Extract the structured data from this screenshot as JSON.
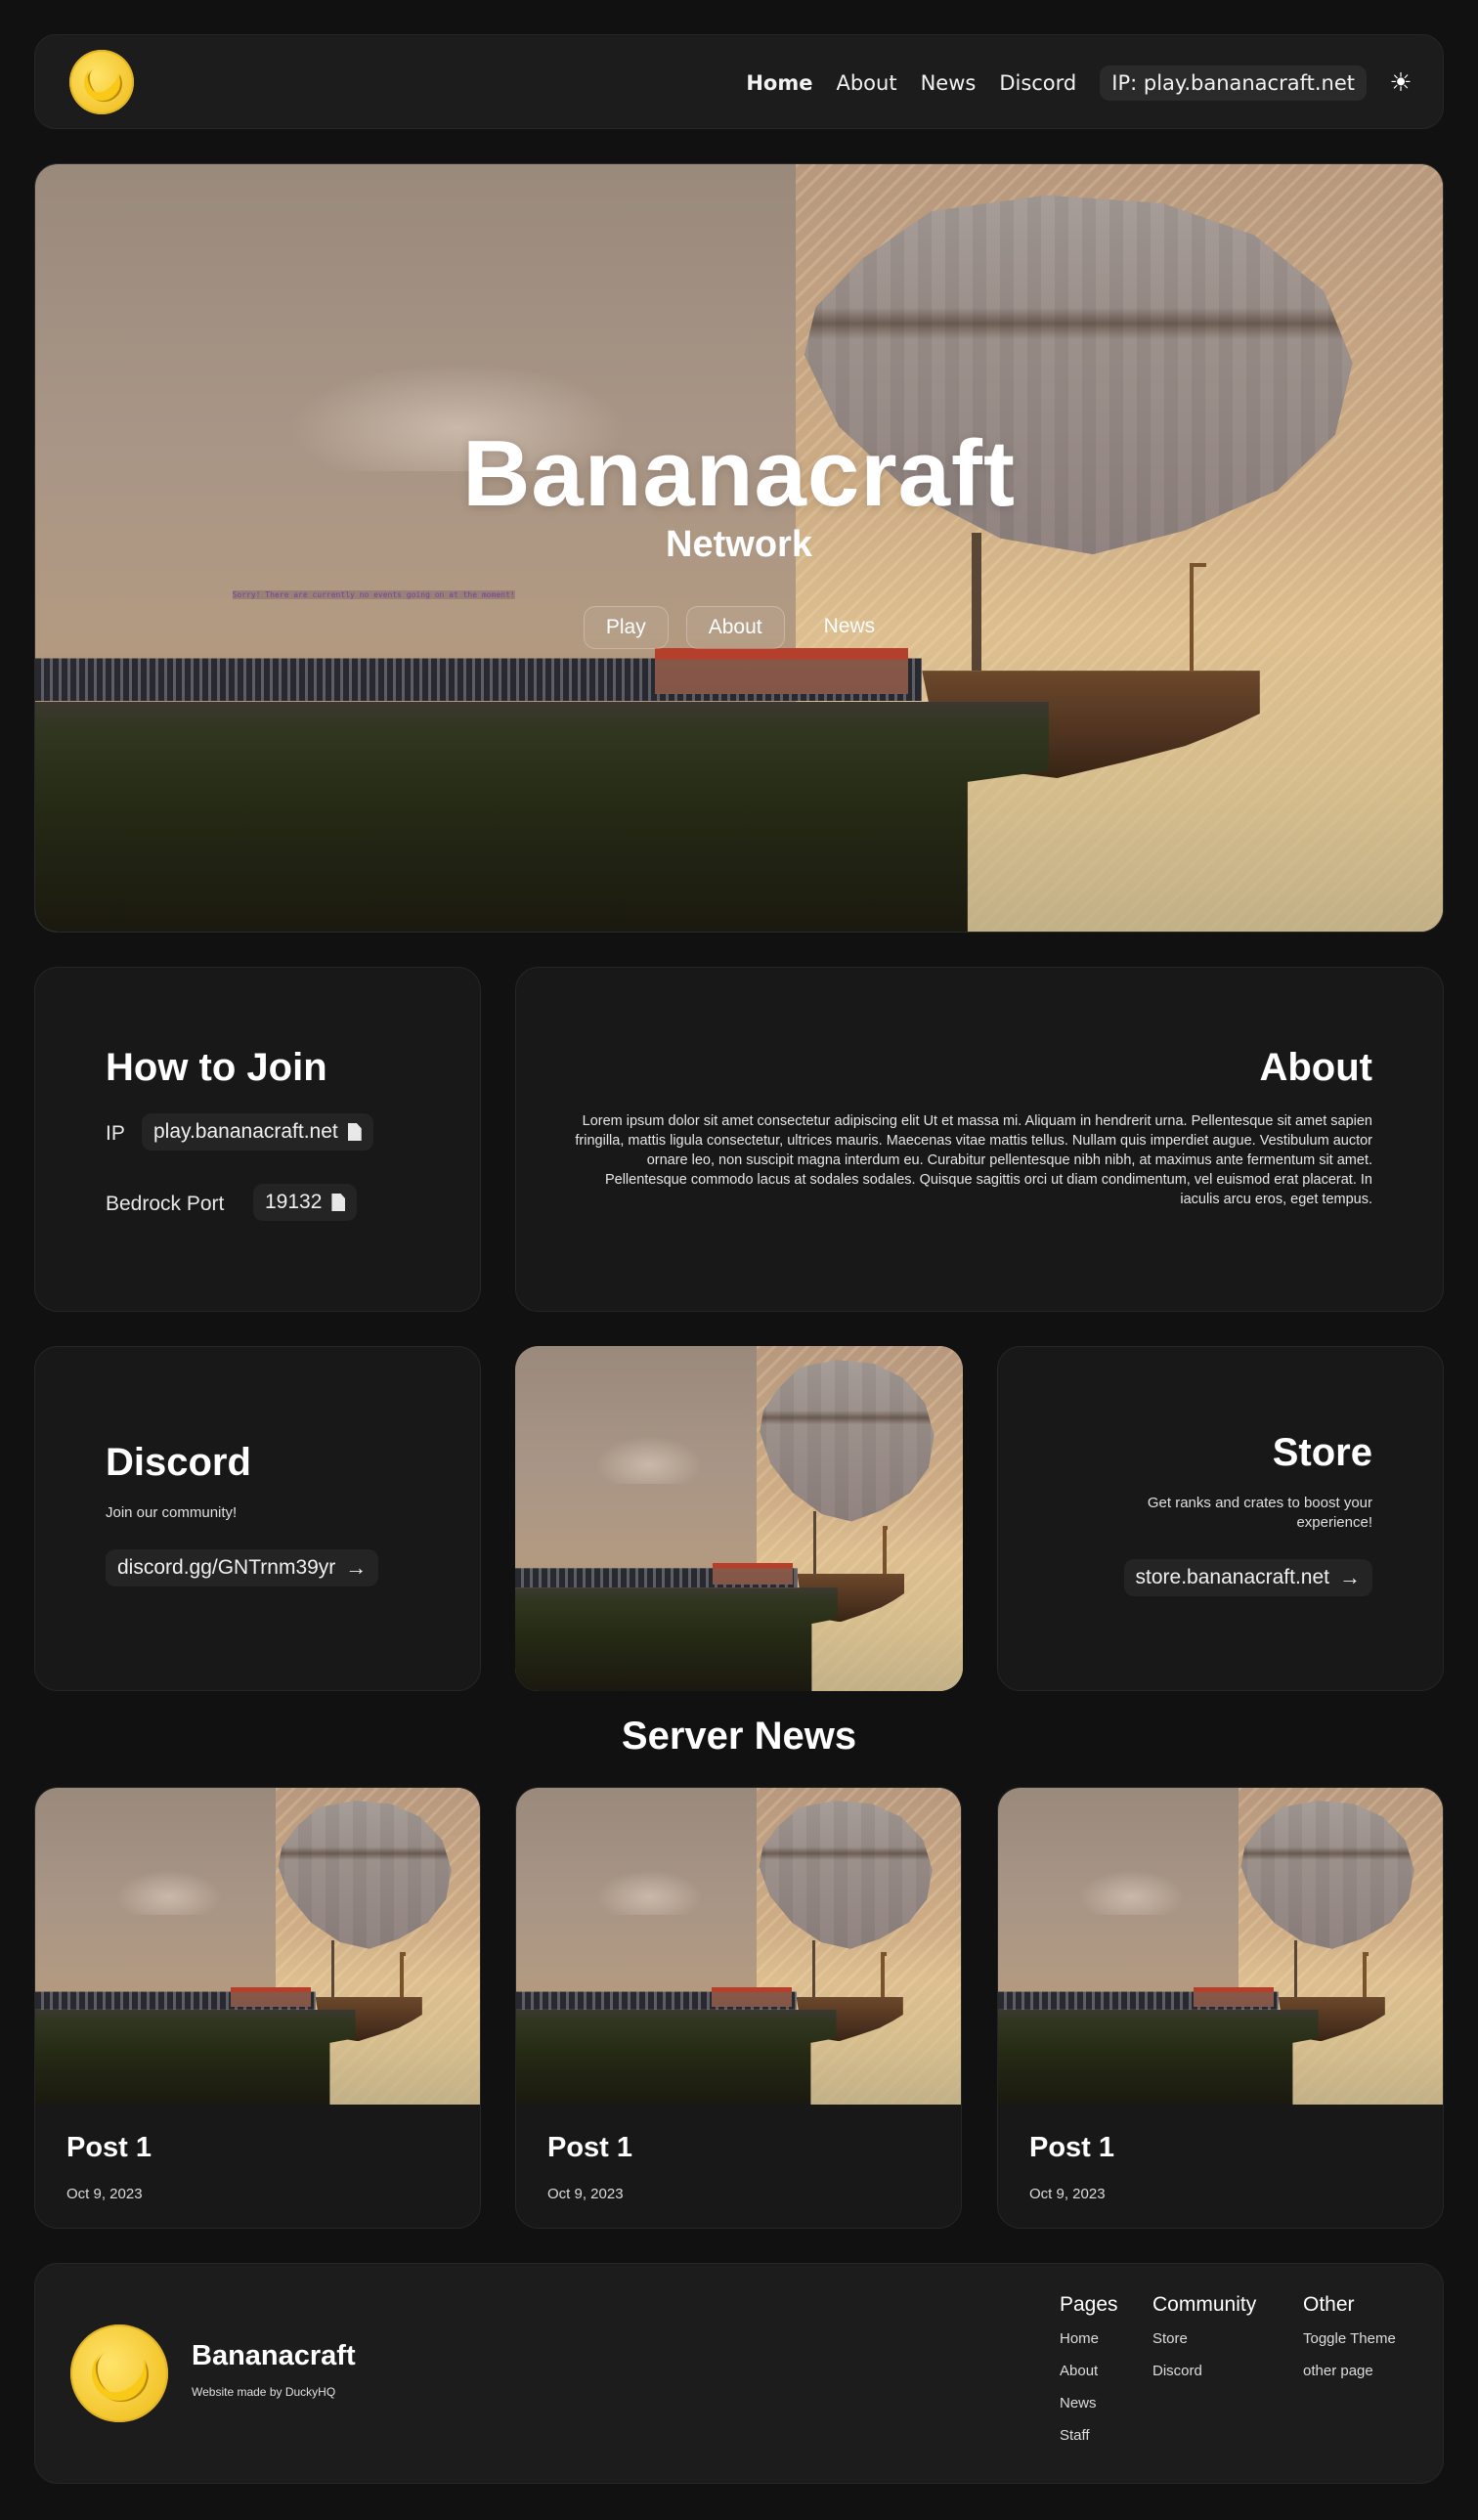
{
  "nav": {
    "links": [
      "Home",
      "About",
      "News",
      "Discord"
    ],
    "ip_label": "IP: play.bananacraft.net",
    "theme_icon": "sun-icon"
  },
  "hero": {
    "title": "Bananacraft",
    "subtitle": "Network",
    "buttons": [
      "Play",
      "About",
      "News"
    ],
    "sign_text": "Sorry! There are currently no events going on at the moment!"
  },
  "join": {
    "title": "How to Join",
    "ip_label": "IP",
    "ip_value": "play.bananacraft.net",
    "port_label": "Bedrock Port",
    "port_value": "19132"
  },
  "about": {
    "title": "About",
    "body": "Lorem ipsum dolor sit amet consectetur adipiscing elit Ut et massa mi. Aliquam in hendrerit urna. Pellentesque sit amet sapien fringilla, mattis ligula consectetur, ultrices mauris. Maecenas vitae mattis tellus. Nullam quis imperdiet augue. Vestibulum auctor ornare leo, non suscipit magna interdum eu. Curabitur pellentesque nibh nibh, at maximus ante fermentum sit amet. Pellentesque commodo lacus at sodales sodales. Quisque sagittis orci ut diam condimentum, vel euismod erat placerat. In iaculis arcu eros, eget tempus."
  },
  "discord": {
    "title": "Discord",
    "tagline": "Join our community!",
    "link": "discord.gg/GNTrnm39yr"
  },
  "store": {
    "title": "Store",
    "tagline": "Get ranks and crates to boost your experience!",
    "link": "store.bananacraft.net"
  },
  "news": {
    "title": "Server News",
    "posts": [
      {
        "title": "Post 1",
        "date": "Oct 9, 2023"
      },
      {
        "title": "Post 1",
        "date": "Oct 9, 2023"
      },
      {
        "title": "Post 1",
        "date": "Oct 9, 2023"
      }
    ]
  },
  "footer": {
    "brand": "Bananacraft",
    "credit": "Website made by DuckyHQ",
    "columns": [
      {
        "heading": "Pages",
        "links": [
          "Home",
          "About",
          "News",
          "Staff"
        ]
      },
      {
        "heading": "Community",
        "links": [
          "Store",
          "Discord"
        ]
      },
      {
        "heading": "Other",
        "links": [
          "Toggle Theme",
          "other page"
        ]
      }
    ]
  },
  "colors": {
    "background": "#111111",
    "card": "#181818",
    "pill": "#242424",
    "accent_yellow": "#f3c52c"
  }
}
